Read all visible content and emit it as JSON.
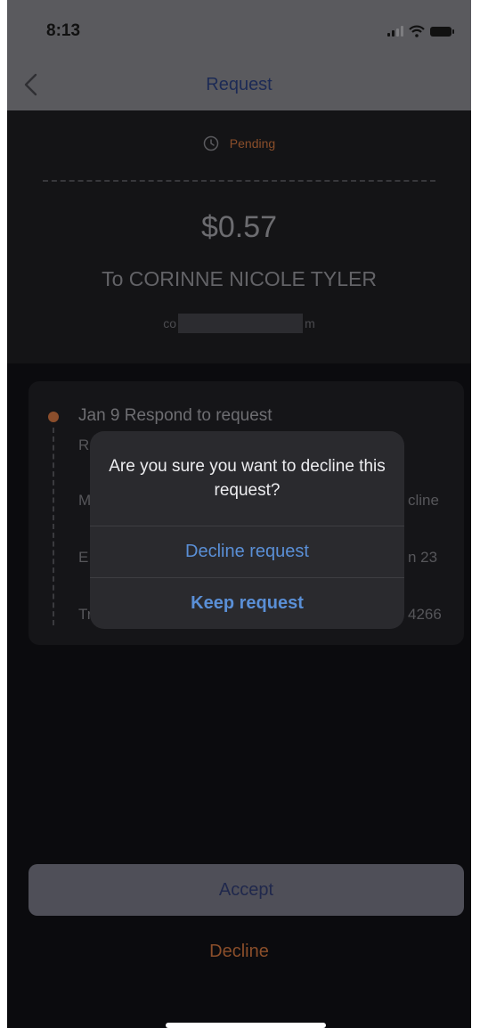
{
  "status_bar": {
    "time": "8:13",
    "icons": [
      "signal-icon",
      "wifi-icon",
      "battery-icon"
    ]
  },
  "nav": {
    "title": "Request",
    "back_icon": "chevron-left-icon"
  },
  "request": {
    "status_icon": "clock-icon",
    "status": "Pending",
    "amount": "$0.57",
    "recipient": "To CORINNE NICOLE TYLER",
    "email_prefix": "co",
    "email_suffix": "m"
  },
  "timeline": {
    "heading": "Jan 9 Respond to request",
    "fragments_left": [
      "R",
      "M",
      "E",
      "Tr"
    ],
    "fragments_right": [
      "cline",
      "n 23",
      "4266"
    ]
  },
  "dialog": {
    "message": "Are you sure you want to decline this request?",
    "decline_label": "Decline request",
    "keep_label": "Keep request"
  },
  "actions": {
    "accept_label": "Accept",
    "decline_label": "Decline"
  },
  "colors": {
    "accent_orange": "#8a4e2a",
    "dialog_blue": "#5a8fd6",
    "dialog_bg": "#2a2a2e"
  }
}
